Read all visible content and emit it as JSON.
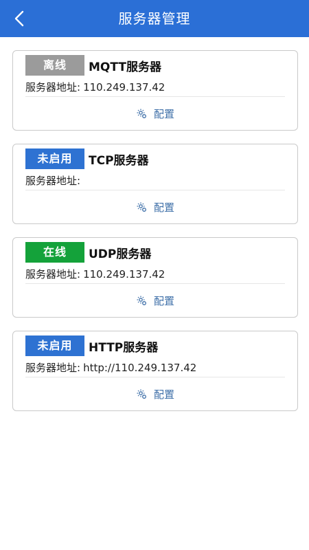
{
  "header": {
    "title": "服务器管理",
    "back_icon": "chevron-left-icon"
  },
  "colors": {
    "header_bg": "#2b6fd6",
    "offline": "#9b9b9b",
    "not_enabled": "#2e72d2",
    "online": "#14a23a",
    "config_text": "#3e6fa8"
  },
  "servers": [
    {
      "status": "离线",
      "status_key": "offline",
      "name": "MQTT服务器",
      "address_label": "服务器地址:",
      "address": "110.249.137.42",
      "config_label": "配置",
      "config_icon": "gear-config-icon"
    },
    {
      "status": "未启用",
      "status_key": "not_enabled",
      "name": "TCP服务器",
      "address_label": "服务器地址:",
      "address": "",
      "config_label": "配置",
      "config_icon": "gear-config-icon"
    },
    {
      "status": "在线",
      "status_key": "online",
      "name": "UDP服务器",
      "address_label": "服务器地址:",
      "address": "110.249.137.42",
      "config_label": "配置",
      "config_icon": "gear-config-icon"
    },
    {
      "status": "未启用",
      "status_key": "not_enabled",
      "name": "HTTP服务器",
      "address_label": "服务器地址:",
      "address": "http://110.249.137.42",
      "config_label": "配置",
      "config_icon": "gear-config-icon"
    }
  ]
}
